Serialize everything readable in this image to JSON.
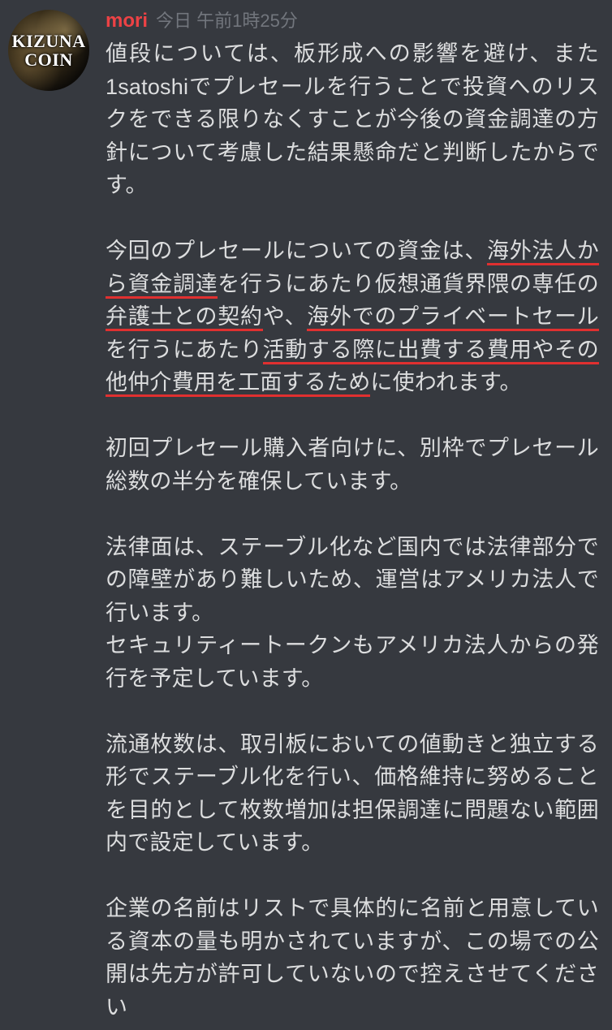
{
  "avatar": {
    "line1": "KIZUNA",
    "line2": "COIN"
  },
  "username": "mori",
  "timestamp": "今日 午前1時25分",
  "paragraphs": {
    "p1": "値段については、板形成への影響を避け、また1satoshiでプレセールを行うことで投資へのリスクをできる限りなくすことが今後の資金調達の方針について考慮した結果懸命だと判断したからです。",
    "p2": {
      "seg1": "今回のプレセールについての資金は、",
      "u1": "海外法人から資金調達",
      "seg2": "を行うにあたり仮想通貨界隈の専任の",
      "u2": "弁護士との契約",
      "seg3": "や、",
      "u3": "海外でのプライベートセール",
      "seg4": "を行うにあたり",
      "u4": "活動する際に出費する費用やその他仲介費用を工面するため",
      "seg5": "に使われます。"
    },
    "p3": "初回プレセール購入者向けに、別枠でプレセール総数の半分を確保しています。",
    "p4a": "法律面は、ステーブル化など国内では法律部分での障壁があり難しいため、運営はアメリカ法人で行います。",
    "p4b": "セキュリティートークンもアメリカ法人からの発行を予定しています。",
    "p5": "流通枚数は、取引板においての値動きと独立する形でステーブル化を行い、価格維持に努めることを目的として枚数増加は担保調達に問題ない範囲内で設定しています。",
    "p6": "企業の名前はリストで具体的に名前と用意している資本の量も明かされていますが、この場での公開は先方が許可していないので控えさせてください"
  }
}
